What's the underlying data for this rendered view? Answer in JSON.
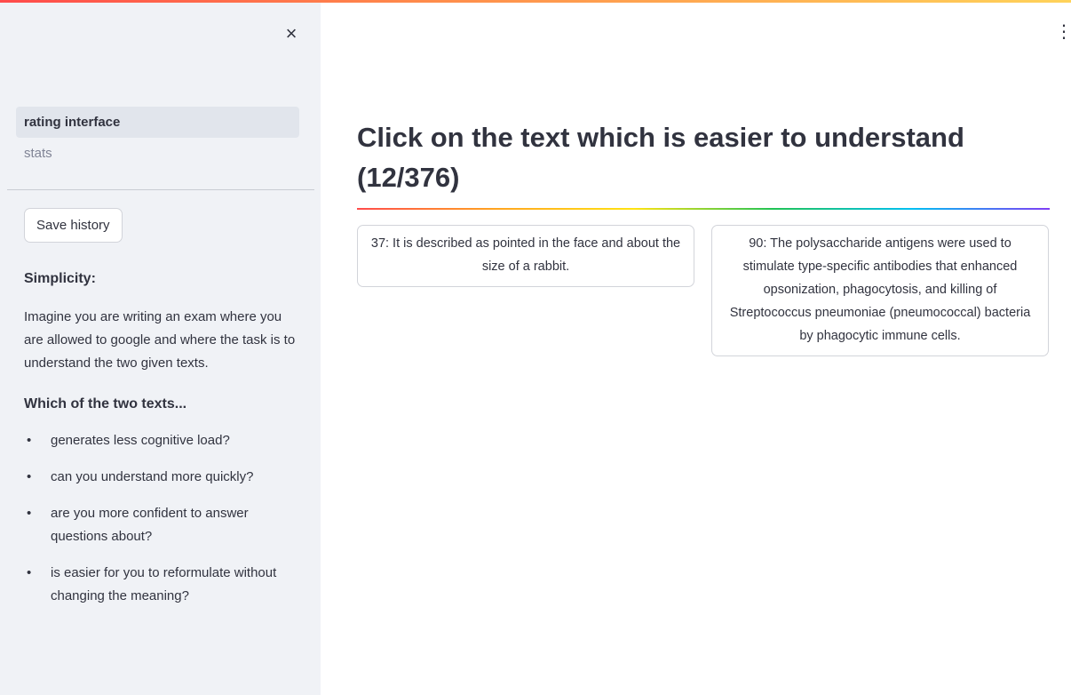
{
  "sidebar": {
    "close_icon": "×",
    "nav": [
      {
        "label": "rating interface",
        "active": true
      },
      {
        "label": "stats",
        "active": false
      }
    ],
    "save_button": "Save history",
    "simplicity_heading": "Simplicity:",
    "instructions": "Imagine you are writing an exam where you are allowed to google and where the task is to understand the two given texts.",
    "question_heading": "Which of the two texts...",
    "bullet_glyph": "•",
    "questions": [
      "generates less cognitive load?",
      "can you understand more quickly?",
      "are you more confident to answer questions about?",
      "is easier for you to reformulate without changing the meaning?"
    ]
  },
  "header": {
    "menu_icon": "⋮"
  },
  "main": {
    "title": "Click on the text which is easier to understand (12/376)",
    "cards": [
      {
        "text": "37: It is described as pointed in the face and about the size of a rabbit."
      },
      {
        "text": "90: The polysaccharide antigens were used to stimulate type-specific antibodies that enhanced opsonization, phagocytosis, and killing of Streptococcus pneumoniae (pneumococcal) bacteria by phagocytic immune cells."
      }
    ]
  },
  "colors": {
    "sidebar_bg": "#f0f2f6",
    "text": "#31333f",
    "muted_text": "#808495",
    "active_nav_bg": "#e1e5ec",
    "border": "#d2d4da"
  }
}
